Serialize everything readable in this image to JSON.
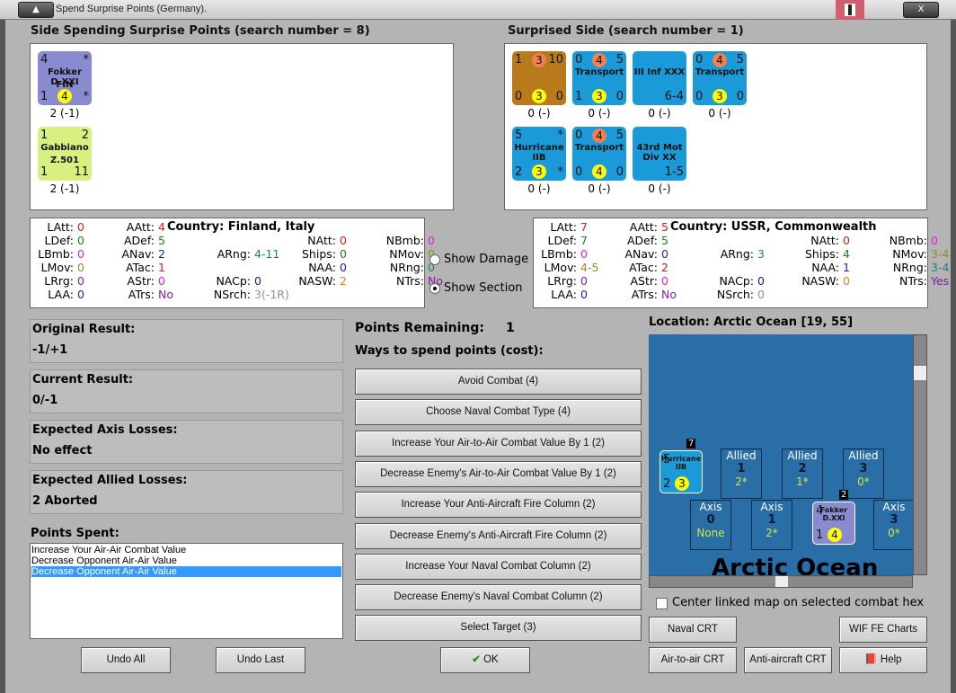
{
  "window": {
    "title": "Spend Surprise Points (Germany)."
  },
  "left_panel": {
    "header": "Side Spending Surprise Points (search number = 8)",
    "units": [
      {
        "name": "Fokker D.XXI",
        "tl": "4",
        "tr": "*",
        "sub": "FIN",
        "bl": "1",
        "circle": "4",
        "br": "*",
        "caption": "2 (-1)",
        "color": "#8a8ad0"
      },
      {
        "name": "Gabbiano",
        "tl": "1",
        "tr": "2",
        "sub": "Z.501",
        "bl": "1",
        "circle": "",
        "br": "11",
        "caption": "2 (-1)",
        "color": "#d8f080"
      }
    ]
  },
  "right_panel": {
    "header": "Surprised Side (search number = 1)",
    "units": [
      {
        "name": "",
        "tl": "1",
        "top": "3",
        "tr": "10",
        "bl": "0",
        "circle": "3",
        "br": "0",
        "caption": "0 (-)",
        "color": "#b87a1a"
      },
      {
        "name": "Transport",
        "tl": "0",
        "top": "4",
        "tr": "5",
        "bl": "1",
        "circle": "3",
        "br": "0",
        "caption": "0 (-)",
        "color": "#1a9ad8"
      },
      {
        "name": "III Inf XXX",
        "tl": "",
        "top": "",
        "tr": "",
        "bl": "",
        "circle": "",
        "br": "6-4",
        "caption": "0 (-)",
        "color": "#1a9ad8"
      },
      {
        "name": "Transport",
        "tl": "0",
        "top": "4",
        "tr": "5",
        "bl": "0",
        "circle": "3",
        "br": "0",
        "caption": "0 (-)",
        "color": "#1a9ad8"
      },
      {
        "name": "Hurricane IIB",
        "tl": "5",
        "top": "",
        "tr": "*",
        "bl": "2",
        "circle": "3",
        "br": "*",
        "caption": "0 (-)",
        "color": "#1a9ad8"
      },
      {
        "name": "Transport",
        "tl": "0",
        "top": "4",
        "tr": "5",
        "bl": "0",
        "circle": "4",
        "br": "0",
        "caption": "0 (-)",
        "color": "#1a9ad8"
      },
      {
        "name": "43rd Mot Div XX",
        "tl": "",
        "top": "",
        "tr": "",
        "bl": "",
        "circle": "",
        "br": "1-5",
        "caption": "0 (-)",
        "color": "#1a9ad8"
      }
    ]
  },
  "left_stats": {
    "country": "Country: Finland, Italy",
    "items": [
      [
        "LAtt:",
        "0",
        "#d02020"
      ],
      [
        "LDef:",
        "0",
        "#208020"
      ],
      [
        "LBmb:",
        "0",
        "#e020e0"
      ],
      [
        "LMov:",
        "0",
        "#909020"
      ],
      [
        "LRrg:",
        "0",
        "#8020a0"
      ],
      [
        "LAA:",
        "0",
        "#2020c0"
      ],
      [
        "AAtt:",
        "4",
        "#d02020"
      ],
      [
        "ADef:",
        "5",
        "#208020"
      ],
      [
        "ANav:",
        "2",
        "#2020c0"
      ],
      [
        "ATac:",
        "1",
        "#c02020"
      ],
      [
        "AStr:",
        "0",
        "#e020e0"
      ],
      [
        "ATrs:",
        "No",
        "#8020a0"
      ],
      [
        "ARng:",
        "4-11",
        "#208080"
      ],
      [
        "NACp:",
        "0",
        "#202080"
      ],
      [
        "NSrch:",
        "3(-1R)",
        "#909090"
      ],
      [
        "NAtt:",
        "0",
        "#d02020"
      ],
      [
        "Ships:",
        "0",
        "#208020"
      ],
      [
        "NAA:",
        "0",
        "#2020c0"
      ],
      [
        "NASW:",
        "2",
        "#e08020"
      ],
      [
        "NBmb:",
        "0",
        "#e020e0"
      ],
      [
        "NMov:",
        "0",
        "#909020"
      ],
      [
        "NRng:",
        "0",
        "#208080"
      ],
      [
        "NTrs:",
        "No",
        "#8020a0"
      ]
    ]
  },
  "right_stats": {
    "country": "Country: USSR, Commonwealth",
    "items": [
      [
        "LAtt:",
        "7",
        "#d02020"
      ],
      [
        "LDef:",
        "7",
        "#208020"
      ],
      [
        "LBmb:",
        "0",
        "#e020e0"
      ],
      [
        "LMov:",
        "4-5",
        "#909020"
      ],
      [
        "LRrg:",
        "0",
        "#8020a0"
      ],
      [
        "LAA:",
        "0",
        "#2020c0"
      ],
      [
        "AAtt:",
        "5",
        "#d02020"
      ],
      [
        "ADef:",
        "5",
        "#208020"
      ],
      [
        "ANav:",
        "0",
        "#2020c0"
      ],
      [
        "ATac:",
        "2",
        "#c02020"
      ],
      [
        "AStr:",
        "0",
        "#e020e0"
      ],
      [
        "ATrs:",
        "No",
        "#8020a0"
      ],
      [
        "ARng:",
        "3",
        "#208080"
      ],
      [
        "NACp:",
        "0",
        "#202080"
      ],
      [
        "NSrch:",
        "0",
        "#909090"
      ],
      [
        "NAtt:",
        "0",
        "#d02020"
      ],
      [
        "Ships:",
        "4",
        "#208020"
      ],
      [
        "NAA:",
        "1",
        "#2020c0"
      ],
      [
        "NASW:",
        "0",
        "#e08020"
      ],
      [
        "NBmb:",
        "0",
        "#e020e0"
      ],
      [
        "NMov:",
        "3-4",
        "#909020"
      ],
      [
        "NRng:",
        "3-4",
        "#208080"
      ],
      [
        "NTrs:",
        "Yes",
        "#8020a0"
      ]
    ]
  },
  "options": {
    "show_damage": "Show Damage",
    "show_section": "Show Section",
    "selected": "show_section"
  },
  "results": [
    {
      "label": "Original Result:",
      "value": "-1/+1"
    },
    {
      "label": "Current Result:",
      "value": "0/-1"
    },
    {
      "label": "Expected Axis Losses:",
      "value": "No effect"
    },
    {
      "label": "Expected Allied Losses:",
      "value": "2 Aborted"
    }
  ],
  "points_spent": {
    "label": "Points Spent:",
    "items": [
      "Increase Your Air-Air Combat Value",
      "Decrease Opponent Air-Air Value",
      "Decrease Opponent Air-Air Value"
    ],
    "selected_index": 2
  },
  "points_remaining": {
    "label": "Points Remaining:",
    "value": "1"
  },
  "ways_label": "Ways to spend points (cost):",
  "ways": [
    "Avoid Combat (4)",
    "Choose Naval Combat Type (4)",
    "Increase Your Air-to-Air Combat Value By 1 (2)",
    "Decrease Enemy's Air-to-Air Combat Value By 1 (2)",
    "Increase Your Anti-Aircraft Fire Column (2)",
    "Decrease Enemy's Anti-Aircraft Fire Column (2)",
    "Increase Your Naval Combat Column (2)",
    "Decrease Enemy's Naval Combat Column (2)",
    "Select Target (3)"
  ],
  "location": "Location: Arctic Ocean [19, 55]",
  "map": {
    "label": "Arctic Ocean",
    "allied_boxes": [
      {
        "side": "Allied",
        "n": "1",
        "v": "2*"
      },
      {
        "side": "Allied",
        "n": "2",
        "v": "1*"
      },
      {
        "side": "Allied",
        "n": "3",
        "v": "0*"
      }
    ],
    "axis_boxes": [
      {
        "side": "Axis",
        "n": "0",
        "v": "None"
      },
      {
        "side": "Axis",
        "n": "1",
        "v": "2*"
      },
      {
        "side": "Axis",
        "n": "3",
        "v": "0*"
      }
    ],
    "allied_unit": {
      "name": "Hurricane IIB",
      "stack": "7",
      "tl": "5",
      "bl": "2",
      "circle": "3"
    },
    "axis_unit": {
      "name": "Fokker D.XXI",
      "stack": "2",
      "tl": "4",
      "bl": "1",
      "circle": "4",
      "sub": "FIN"
    }
  },
  "center_map": {
    "label": "Center linked map on selected combat hex",
    "checked": false
  },
  "buttons": {
    "undo_all": "Undo All",
    "undo_last": "Undo Last",
    "ok": "OK",
    "naval_crt": "Naval CRT",
    "wif_charts": "WIF FE Charts",
    "air_crt": "Air-to-air CRT",
    "aa_crt": "Anti-aircraft CRT",
    "help": "Help"
  }
}
